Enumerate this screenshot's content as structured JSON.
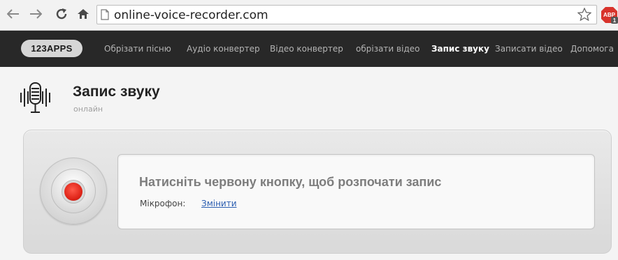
{
  "browser": {
    "url": "online-voice-recorder.com",
    "abp_badge": "ABP",
    "abp_count": "1"
  },
  "nav": {
    "logo": "123APPS",
    "links": [
      "Обрізати пісню",
      "Аудіо конвертер",
      "Відео конвертер",
      "обрізати відео",
      "Запис звуку",
      "Записати відео",
      "Допомога"
    ]
  },
  "page": {
    "title": "Запис звуку",
    "subtitle": "онлайн"
  },
  "recorder": {
    "instruction": "Натисніть червону кнопку, щоб розпочати запис",
    "mic_label": "Мікрофон:",
    "change_link": "Змінити"
  },
  "colors": {
    "record_red": "#e0261a",
    "nav_bg": "#282828",
    "link_blue": "#2a5db0"
  },
  "icons": [
    "back-arrow-icon",
    "forward-arrow-icon",
    "reload-icon",
    "home-icon",
    "page-icon",
    "star-icon",
    "adblock-icon",
    "microphone-icon"
  ]
}
